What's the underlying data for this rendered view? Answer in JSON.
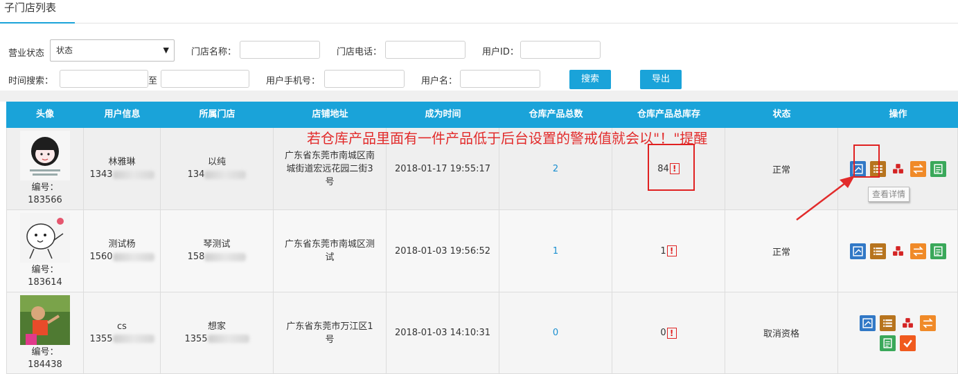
{
  "tab": {
    "title": "子门店列表"
  },
  "filters": {
    "status_label": "营业状态",
    "status_value": "状态",
    "store_name_label": "门店名称：",
    "store_phone_label": "门店电话：",
    "user_id_label": "用户ID：",
    "time_label": "时间搜索：",
    "to_label": "至",
    "user_phone_label": "用户手机号：",
    "username_label": "用户名：",
    "search_button": "搜索",
    "export_button": "导出"
  },
  "table": {
    "headers": [
      "头像",
      "用户信息",
      "所属门店",
      "店铺地址",
      "成为时间",
      "仓库产品总数",
      "仓库产品总库存",
      "状态",
      "操作"
    ],
    "rows": [
      {
        "id_label": "编号：",
        "id": "183566",
        "user_name": "林雅琳",
        "user_phone": "1343",
        "store_name": "以纯",
        "store_phone": "134",
        "address": "广东省东莞市南城区南城街道宏远花园二街3号",
        "time": "2018-01-17 19:55:17",
        "product_total": "2",
        "stock_total": "84",
        "status": "正常"
      },
      {
        "id_label": "编号：",
        "id": "183614",
        "user_name": "测试杨",
        "user_phone": "1560",
        "store_name": "琴测试",
        "store_phone": "158",
        "address": "广东省东莞市南城区测试",
        "time": "2018-01-03 19:56:52",
        "product_total": "1",
        "stock_total": "1",
        "status": "正常"
      },
      {
        "id_label": "编号：",
        "id": "184438",
        "user_name": "cs",
        "user_phone": "1355",
        "store_name": "想家",
        "store_phone": "1355",
        "address": "广东省东莞市万江区1号",
        "time": "2018-01-03 14:10:31",
        "product_total": "0",
        "stock_total": "0",
        "status": "取消资格"
      }
    ],
    "warn_symbol": "!"
  },
  "annotation": {
    "note": "若仓库产品里面有一件产品低于后台设置的警戒值就会以\"！\"提醒",
    "tooltip": "查看详情"
  },
  "colors": {
    "header_blue": "#1aa3d9",
    "warning_red": "#e02020",
    "annotation_red": "#e22b2b"
  },
  "icons": {
    "detail": "view-detail-icon",
    "list": "list-icon",
    "cubes": "warehouse-cubes-icon",
    "transfer": "transfer-icon",
    "report": "report-icon",
    "approve": "check-icon"
  }
}
